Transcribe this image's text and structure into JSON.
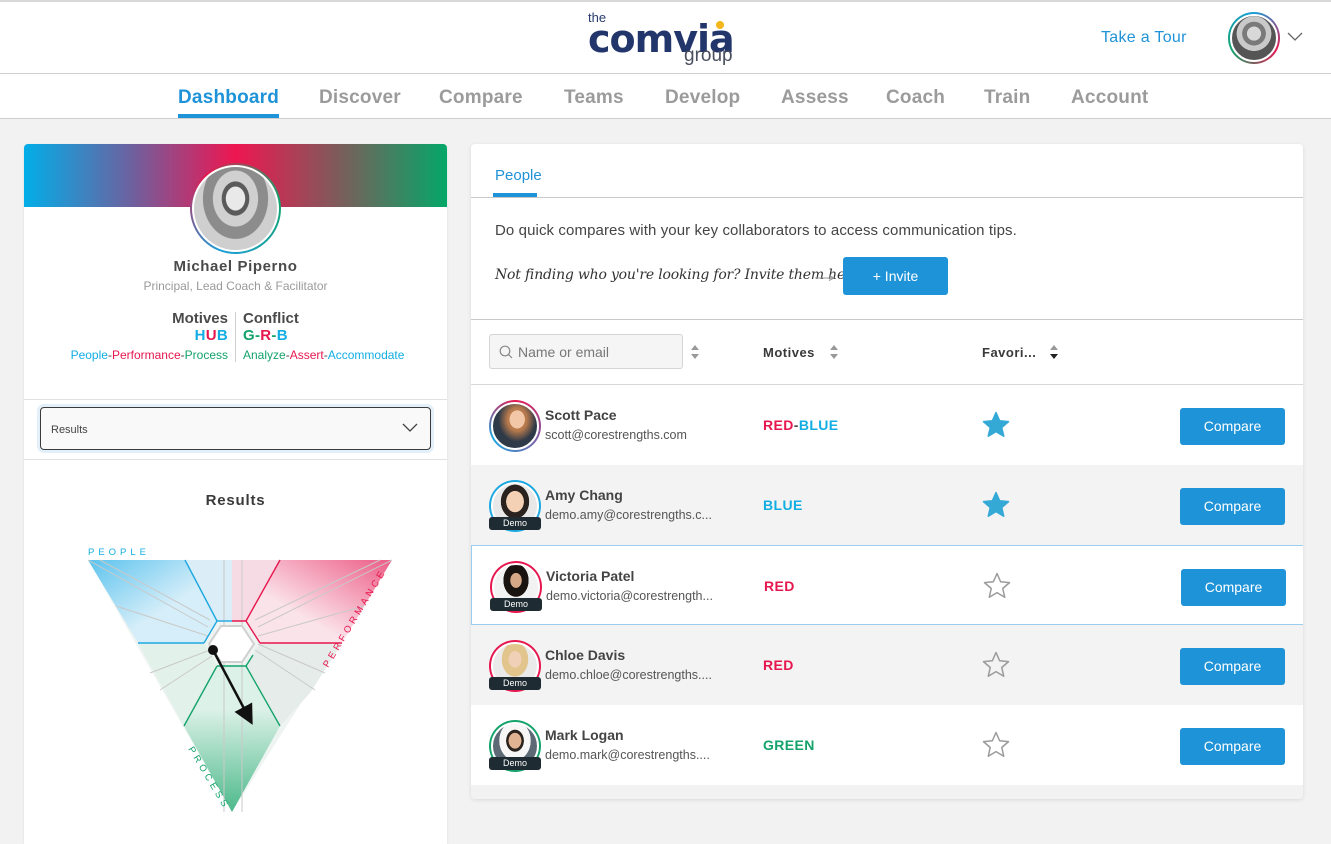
{
  "header": {
    "logo": {
      "the": "the",
      "name": "comvia",
      "group": "group"
    },
    "tour_link": "Take a Tour",
    "user_menu_icon": "chevron-down-icon"
  },
  "nav": {
    "items": [
      {
        "label": "Dashboard",
        "active": true
      },
      {
        "label": "Discover",
        "active": false
      },
      {
        "label": "Compare",
        "active": false
      },
      {
        "label": "Teams",
        "active": false
      },
      {
        "label": "Develop",
        "active": false
      },
      {
        "label": "Assess",
        "active": false
      },
      {
        "label": "Coach",
        "active": false
      },
      {
        "label": "Train",
        "active": false
      },
      {
        "label": "Account",
        "active": false
      }
    ]
  },
  "profile": {
    "name": "Michael Piperno",
    "title": "Principal, Lead Coach & Facilitator",
    "motives": {
      "label": "Motives",
      "code": [
        {
          "t": "H",
          "c": "blue"
        },
        {
          "t": "U",
          "c": "red"
        },
        {
          "t": "B",
          "c": "blue"
        }
      ],
      "sub": [
        {
          "t": "People",
          "c": "blue"
        },
        {
          "t": "-",
          "c": "dark"
        },
        {
          "t": "Performance",
          "c": "red"
        },
        {
          "t": "-",
          "c": "dark"
        },
        {
          "t": "Process",
          "c": "green"
        }
      ]
    },
    "conflict": {
      "label": "Conflict",
      "code": [
        {
          "t": "G",
          "c": "green"
        },
        {
          "t": "-",
          "c": "green"
        },
        {
          "t": "R",
          "c": "red"
        },
        {
          "t": "-",
          "c": "green"
        },
        {
          "t": "B",
          "c": "blue"
        }
      ],
      "sub": [
        {
          "t": "Analyze",
          "c": "green"
        },
        {
          "t": "-",
          "c": "dark"
        },
        {
          "t": "Assert",
          "c": "red"
        },
        {
          "t": "-",
          "c": "dark"
        },
        {
          "t": "Accommodate",
          "c": "blue"
        }
      ]
    },
    "view_select": {
      "value": "Results"
    },
    "results_title": "Results",
    "triangle": {
      "labels": {
        "people": "PEOPLE",
        "performance": "PERFORMANCE",
        "process": "PROCESS"
      },
      "arrow": {
        "start_label": "conflict-start-dot",
        "end_label": "conflict-end-arrow"
      }
    }
  },
  "people_panel": {
    "tab": "People",
    "intro": "Do quick compares with your key collaborators to access communication tips.",
    "invite_hint": "Not finding who you're looking for? Invite them here",
    "invite_button": "+ Invite",
    "search": {
      "placeholder": "Name or email",
      "value": ""
    },
    "columns": {
      "motives": "Motives",
      "favorite": "Favori..."
    },
    "compare_label": "Compare",
    "demo_label": "Demo",
    "people": [
      {
        "name": "Scott Pace",
        "email": "scott@corestrengths.com",
        "motive": [
          {
            "t": "RED",
            "c": "red"
          },
          {
            "t": "-",
            "c": "dark"
          },
          {
            "t": "BLUE",
            "c": "blue"
          }
        ],
        "favorite": true,
        "demo": false,
        "ring": "grad-rb"
      },
      {
        "name": "Amy Chang",
        "email": "demo.amy@corestrengths.c...",
        "motive": [
          {
            "t": "BLUE",
            "c": "blue"
          }
        ],
        "favorite": true,
        "demo": true,
        "ring": "blue"
      },
      {
        "name": "Victoria Patel",
        "email": "demo.victoria@corestrength...",
        "motive": [
          {
            "t": "RED",
            "c": "red"
          }
        ],
        "favorite": false,
        "demo": true,
        "ring": "red"
      },
      {
        "name": "Chloe Davis",
        "email": "demo.chloe@corestrengths....",
        "motive": [
          {
            "t": "RED",
            "c": "red"
          }
        ],
        "favorite": false,
        "demo": true,
        "ring": "red"
      },
      {
        "name": "Mark Logan",
        "email": "demo.mark@corestrengths....",
        "motive": [
          {
            "t": "GREEN",
            "c": "green"
          }
        ],
        "favorite": false,
        "demo": true,
        "ring": "green"
      }
    ]
  },
  "colors": {
    "accent": "#1f93d8",
    "blue": "#12aee3",
    "red": "#e6174e",
    "green": "#14a36b",
    "star_filled": "#34a9d6",
    "star_empty": "#9b9b9b"
  }
}
